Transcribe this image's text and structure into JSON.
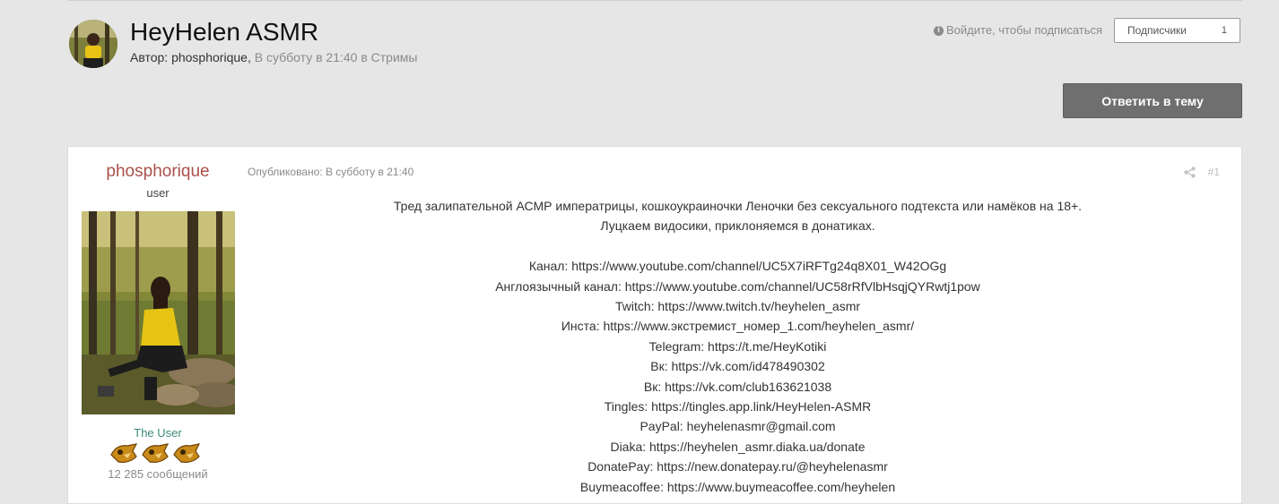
{
  "header": {
    "title": "HeyHelen ASMR",
    "byline_prefix": "Автор:",
    "author": "phosphorique",
    "byline_suffix": "В субботу в 21:40 в Стримы",
    "login_hint": "Войдите, чтобы подписаться",
    "subscribers_label": "Подписчики",
    "subscribers_count": "1",
    "reply_button": "Ответить в тему"
  },
  "post": {
    "author_name": "phosphorique",
    "author_role": "user",
    "author_group": "The User",
    "author_post_count": "12 285 сообщений",
    "published": "Опубликовано: В субботу в 21:40",
    "post_number": "#1",
    "lines": [
      "Тред залипательной АСМР императрицы, кошкоукраиночки Леночки без сексуального подтекста или намёков на 18+.",
      "Луцкаем видосики, приклоняемся в донатиках.",
      "",
      "Канал: https://www.youtube.com/channel/UC5X7iRFTg24q8X01_W42OGg",
      "Англоязычный канал: https://www.youtube.com/channel/UC58rRfVlbHsqjQYRwtj1pow",
      "Twitch: https://www.twitch.tv/heyhelen_asmr",
      "Инста: https://www.экстремист_номер_1.com/heyhelen_asmr/",
      "Telegram: https://t.me/HeyKotiki",
      "Вк: https://vk.com/id478490302",
      "Вк: https://vk.com/club163621038",
      "Tingles: https://tingles.app.link/HeyHelen-ASMR",
      "PayPal: heyhelenasmr@gmail.com",
      "Diaka: https://heyhelen_asmr.diaka.ua/donate",
      "DonatePay: https://new.donatepay.ru/@heyhelenasmr",
      "Buymeacoffee: https://www.buymeacoffee.com/heyhelen"
    ]
  },
  "icons": {
    "info": "info-icon",
    "share": "share-icon",
    "badge": "rank-badge-icon"
  },
  "colors": {
    "author_name": "#a9504a",
    "group": "#3a8a7a",
    "reply_button_bg": "#6f6f6f"
  }
}
